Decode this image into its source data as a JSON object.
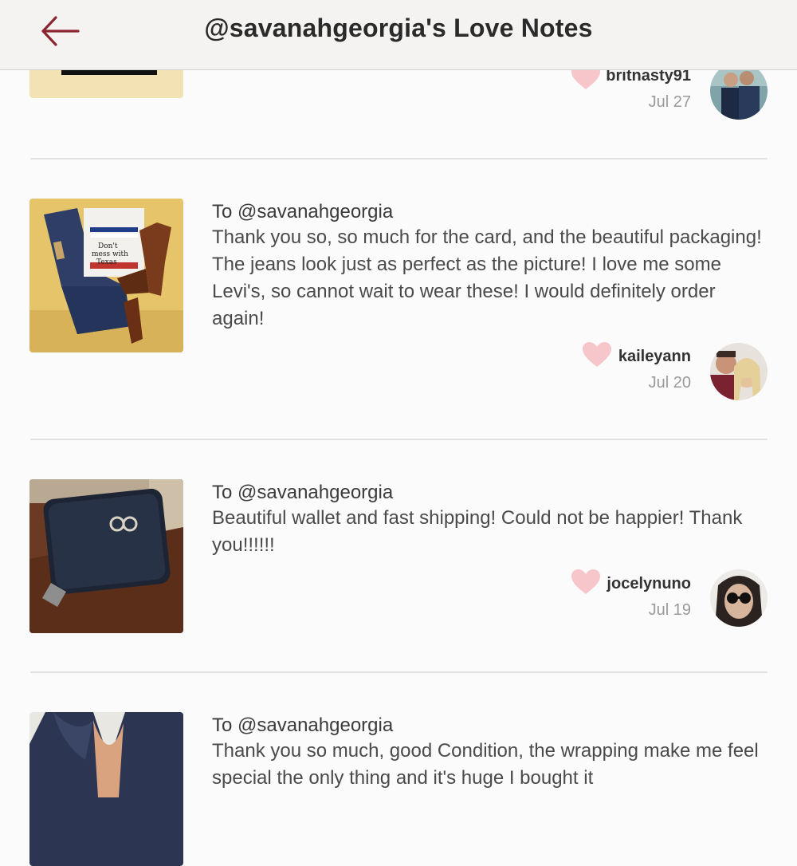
{
  "header": {
    "title": "@savanahgeorgia's Love Notes",
    "back_icon": "back-arrow-icon",
    "accent_color": "#8b2530"
  },
  "notes": [
    {
      "to": "",
      "message": "",
      "username": "britnasty91",
      "date": "Jul 27"
    },
    {
      "to": "To @savanahgeorgia",
      "message": "Thank you so, so much for the card, and the beautiful packaging! The jeans look just as perfect as the picture! I love me some Levi's, so cannot wait to wear these! I would definitely order again!",
      "username": "kaileyann",
      "date": "Jul 20",
      "photo_text": "Don't mess with Texas"
    },
    {
      "to": "To @savanahgeorgia",
      "message": "Beautiful wallet and fast shipping! Could not be happier! Thank you!!!!!!",
      "username": "jocelynuno",
      "date": "Jul 19"
    },
    {
      "to": "To @savanahgeorgia",
      "message": "Thank you so much, good Condition, the wrapping make me feel special the only thing and it's huge I bought it"
    }
  ],
  "heart_color": "#f6c6cb"
}
